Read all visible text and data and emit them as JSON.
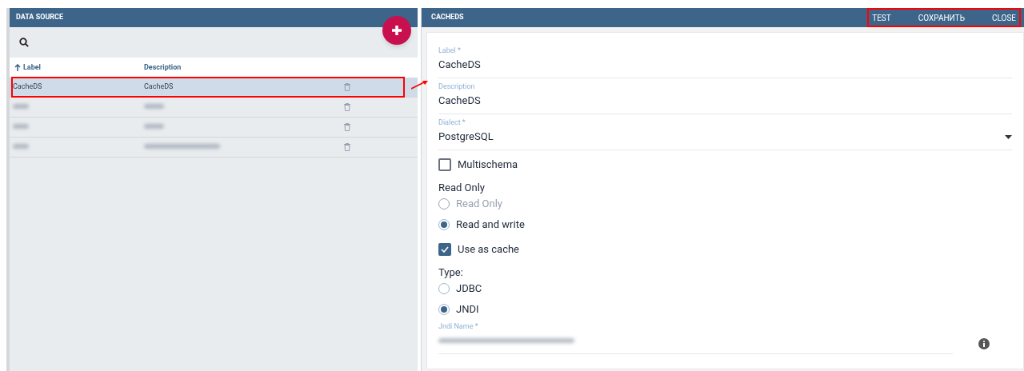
{
  "list_panel": {
    "title": "DATA SOURCE",
    "columns": [
      {
        "label": "Label",
        "sorted": true
      },
      {
        "label": "Description",
        "sorted": false
      }
    ],
    "rows": [
      {
        "kind": "text",
        "label": "CacheDS",
        "description": "CacheDS",
        "selected": true,
        "highlighted": true
      },
      {
        "kind": "blurred",
        "selected": false,
        "highlighted": false
      },
      {
        "kind": "blurred",
        "selected": false,
        "highlighted": false
      },
      {
        "kind": "blurred",
        "selected": false,
        "highlighted": false
      }
    ]
  },
  "detail_panel": {
    "title": "CACHEDS",
    "actions": [
      "TEST",
      "СОХРАНИТЬ",
      "CLOSE"
    ],
    "actions_highlighted": true,
    "fields": [
      {
        "kind": "text",
        "label": "Label *",
        "value": "CacheDS"
      },
      {
        "kind": "text",
        "label": "Description",
        "value": "CacheDS"
      },
      {
        "kind": "select",
        "label": "Dialect *",
        "value": "PostgreSQL"
      },
      {
        "kind": "checkbox",
        "label": "Multischema",
        "checked": false
      },
      {
        "kind": "heading",
        "label": "Read Only"
      },
      {
        "kind": "radio",
        "label": "Read Only",
        "selected": false,
        "disabled": true
      },
      {
        "kind": "radio",
        "label": "Read and write",
        "selected": true,
        "disabled": false
      },
      {
        "kind": "checkbox",
        "label": "Use as cache",
        "checked": true
      },
      {
        "kind": "heading",
        "label": "Type:"
      },
      {
        "kind": "radio",
        "label": "JDBC",
        "selected": false,
        "disabled": false
      },
      {
        "kind": "radio",
        "label": "JNDI",
        "selected": true,
        "disabled": false
      },
      {
        "kind": "blurred-text",
        "label": "Jndi Name *"
      }
    ]
  }
}
